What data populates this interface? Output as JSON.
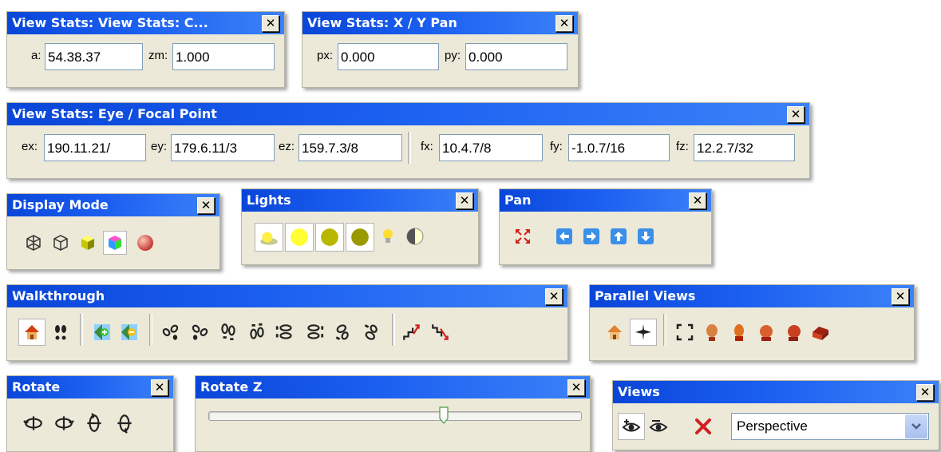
{
  "toolbars": {
    "view_stats_c": {
      "title": "View Stats: View Stats: C...",
      "close": "✕",
      "a_label": "a:",
      "a_value": "54.38.37",
      "zm_label": "zm:",
      "zm_value": "1.000"
    },
    "view_stats_xy": {
      "title": "View Stats: X / Y Pan",
      "close": "✕",
      "px_label": "px:",
      "px_value": "0.000",
      "py_label": "py:",
      "py_value": "0.000"
    },
    "view_stats_eye": {
      "title": "View Stats: Eye / Focal Point",
      "close": "✕",
      "ex_label": "ex:",
      "ex_value": "190.11.21/",
      "ey_label": "ey:",
      "ey_value": "179.6.11/3",
      "ez_label": "ez:",
      "ez_value": "159.7.3/8",
      "fx_label": "fx:",
      "fx_value": "10.4.7/8",
      "fy_label": "fy:",
      "fy_value": "-1.0.7/16",
      "fz_label": "fz:",
      "fz_value": "12.2.7/32"
    },
    "display_mode": {
      "title": "Display Mode",
      "close": "✕"
    },
    "lights": {
      "title": "Lights",
      "close": "✕"
    },
    "pan": {
      "title": "Pan",
      "close": "✕"
    },
    "walkthrough": {
      "title": "Walkthrough",
      "close": "✕"
    },
    "parallel_views": {
      "title": "Parallel Views",
      "close": "✕"
    },
    "rotate": {
      "title": "Rotate",
      "close": "✕"
    },
    "rotate_z": {
      "title": "Rotate Z",
      "close": "✕",
      "slider_value": 0.63
    },
    "views": {
      "title": "Views",
      "close": "✕",
      "select_value": "Perspective",
      "dropdown_icon": "chevron-down-icon"
    }
  },
  "colors": {
    "title_bar": "#0a46d8",
    "toolbar_bg": "#ece9d8",
    "input_border": "#7f9db9"
  }
}
